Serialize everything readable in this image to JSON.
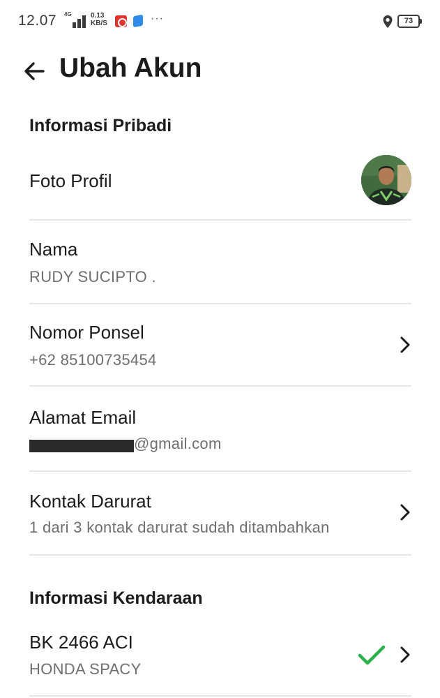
{
  "status_bar": {
    "time": "12.07",
    "network_tag": "4G",
    "speed_value": "0.13",
    "speed_unit": "KB/S",
    "more": "···",
    "battery": "73",
    "icons": [
      "signal-icon",
      "red-app-icon",
      "blue-app-icon",
      "location-pin-icon",
      "battery-icon"
    ]
  },
  "header": {
    "title": "Ubah Akun",
    "back_icon": "arrow-left-icon"
  },
  "personal": {
    "section_title": "Informasi Pribadi",
    "photo_label": "Foto Profil",
    "name_label": "Nama",
    "name_value": "RUDY SUCIPTO .",
    "phone_label": "Nomor Ponsel",
    "phone_value": "+62 85100735454",
    "email_label": "Alamat Email",
    "email_value_visible": "@gmail.com",
    "emergency_label": "Kontak Darurat",
    "emergency_value": "1 dari 3 kontak darurat sudah ditambahkan"
  },
  "vehicle": {
    "section_title": "Informasi Kendaraan",
    "plate": "BK 2466 ACI",
    "model": "HONDA SPACY",
    "verified_icon": "check-icon"
  },
  "colors": {
    "text_primary": "#1c1c1c",
    "text_secondary": "#6e6e6e",
    "divider": "#e6e6e6",
    "check_green": "#2db14a"
  }
}
